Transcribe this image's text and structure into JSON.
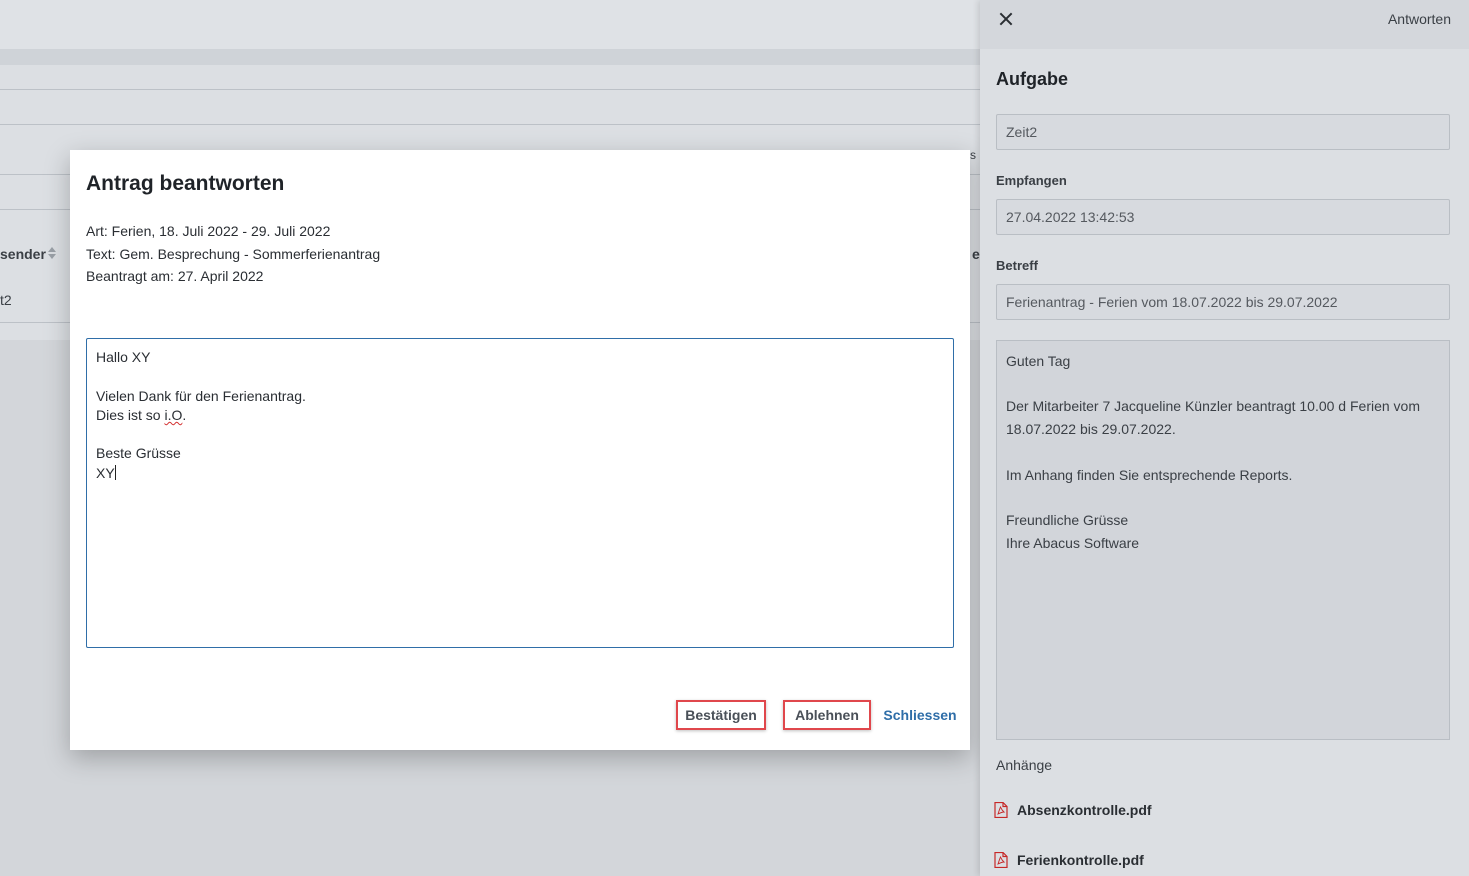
{
  "background": {
    "column_header": "sender",
    "row_value": "t2",
    "header_fragment_1": "s",
    "header_fragment_2": "e"
  },
  "modal": {
    "title": "Antrag beantworten",
    "info": [
      "Art: Ferien, 18. Juli 2022 - 29. Juli 2022",
      "Text: Gem. Besprechung - Sommerferienantrag",
      "Beantragt am: 27. April 2022"
    ],
    "message": {
      "line1": "Hallo XY",
      "line2": "Vielen Dank für den Ferienantrag.",
      "line3_prefix": "Dies ist so ",
      "line3_misspelled": "i.O",
      "line3_suffix": ".",
      "line4": "Beste Grüsse",
      "line5": "XY"
    },
    "buttons": {
      "confirm": "Bestätigen",
      "reject": "Ablehnen",
      "close": "Schliessen"
    }
  },
  "panel": {
    "reply_label": "Antworten",
    "title": "Aufgabe",
    "task_value": "Zeit2",
    "received_label": "Empfangen",
    "received_value": "27.04.2022 13:42:53",
    "subject_label": "Betreff",
    "subject_value": "Ferienantrag - Ferien vom 18.07.2022 bis 29.07.2022",
    "body": "Guten Tag\n\nDer Mitarbeiter 7 Jacqueline Künzler beantragt 10.00 d Ferien vom 18.07.2022 bis 29.07.2022.\n\nIm Anhang finden Sie entsprechende Reports.\n\nFreundliche Grüsse\nIhre Abacus Software",
    "attachments_label": "Anhänge",
    "attachments": [
      "Absenzkontrolle.pdf",
      "Ferienkontrolle.pdf"
    ]
  },
  "colors": {
    "accent": "#2f6ea8",
    "highlight_border": "#e0474c",
    "pdf_icon": "#c62828"
  }
}
